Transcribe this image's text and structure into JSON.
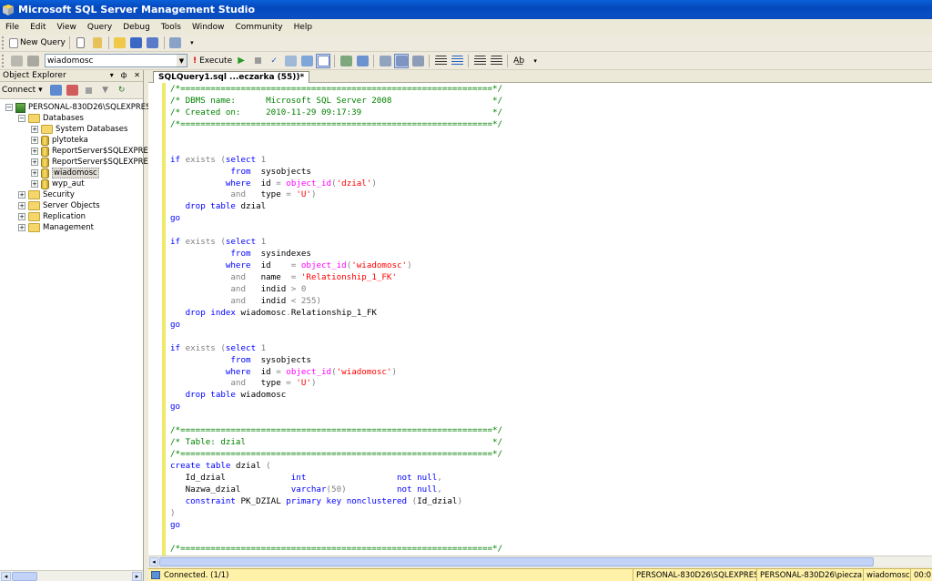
{
  "window": {
    "title": "Microsoft SQL Server Management Studio"
  },
  "menu": [
    "File",
    "Edit",
    "View",
    "Query",
    "Debug",
    "Tools",
    "Window",
    "Community",
    "Help"
  ],
  "toolbar": {
    "new_query_label": "New Query",
    "database": "wiadomosc",
    "execute_label": "Execute"
  },
  "object_explorer": {
    "title": "Object Explorer",
    "connect_label": "Connect",
    "tree": {
      "server": "PERSONAL-830D26\\SQLEXPRESS",
      "databases": "Databases",
      "system_databases": "System Databases",
      "db1": "plytoteka",
      "db2": "ReportServer$SQLEXPRESS",
      "db3": "ReportServer$SQLEXPRESS",
      "db4": "wiadomosc",
      "db5": "wyp_aut",
      "security": "Security",
      "server_objects": "Server Objects",
      "replication": "Replication",
      "management": "Management"
    }
  },
  "editor": {
    "tab_label": "SQLQuery1.sql ...eczarka (55))*",
    "lines": [
      "/*==============================================================*/",
      "/* DBMS name:      Microsoft SQL Server 2008                    */",
      "/* Created on:     2010-11-29 09:17:39                          */",
      "/*==============================================================*/",
      "",
      "",
      "if exists (select 1",
      "            from  sysobjects",
      "           where  id = object_id('dzial')",
      "            and   type = 'U')",
      "   drop table dzial",
      "go",
      "",
      "if exists (select 1",
      "            from  sysindexes",
      "           where  id    = object_id('wiadomosc')",
      "            and   name  = 'Relationship_1_FK'",
      "            and   indid > 0",
      "            and   indid < 255)",
      "   drop index wiadomosc.Relationship_1_FK",
      "go",
      "",
      "if exists (select 1",
      "            from  sysobjects",
      "           where  id = object_id('wiadomosc')",
      "            and   type = 'U')",
      "   drop table wiadomosc",
      "go",
      "",
      "/*==============================================================*/",
      "/* Table: dzial                                                 */",
      "/*==============================================================*/",
      "create table dzial (",
      "   Id_dzial             int                  not null,",
      "   Nazwa_dzial          varchar(50)          not null,",
      "   constraint PK_DZIAL primary key nonclustered (Id_dzial)",
      ")",
      "go",
      "",
      "/*==============================================================*/"
    ]
  },
  "status": {
    "connection": "Connected. (1/1)",
    "server": "PERSONAL-830D26\\SQLEXPRESS ...",
    "user": "PERSONAL-830D26\\piecza...",
    "database": "wiadomosc",
    "time": "00:0"
  }
}
